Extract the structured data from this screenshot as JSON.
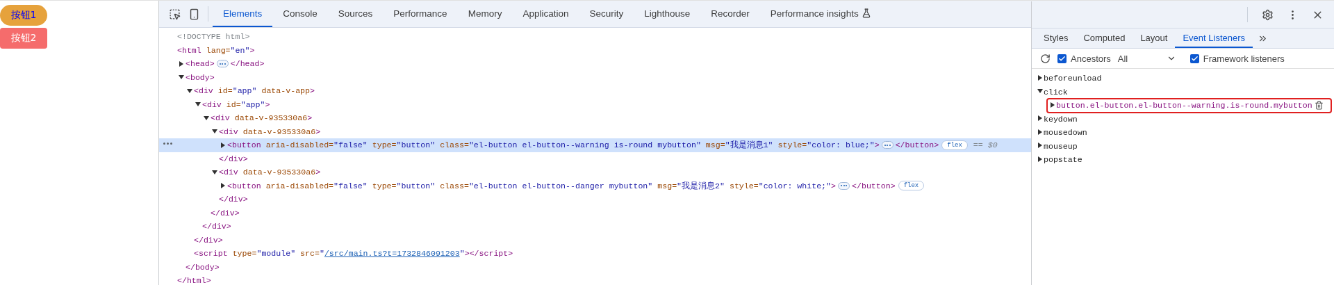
{
  "page": {
    "buttons": [
      {
        "label": "按钮1",
        "kind": "warning"
      },
      {
        "label": "按钮2",
        "kind": "danger"
      }
    ]
  },
  "devtools": {
    "tabs": [
      {
        "label": "Elements",
        "selected": true
      },
      {
        "label": "Console",
        "selected": false
      },
      {
        "label": "Sources",
        "selected": false
      },
      {
        "label": "Performance",
        "selected": false
      },
      {
        "label": "Memory",
        "selected": false
      },
      {
        "label": "Application",
        "selected": false
      },
      {
        "label": "Security",
        "selected": false
      },
      {
        "label": "Lighthouse",
        "selected": false
      },
      {
        "label": "Recorder",
        "selected": false
      },
      {
        "label": "Performance insights",
        "selected": false,
        "experimental": true
      }
    ],
    "dom_tree": [
      {
        "selected": false,
        "tokens": [
          {
            "kind": "doctype",
            "text": "<!DOCTYPE html>"
          }
        ]
      },
      {
        "selected": false,
        "tokens": [
          {
            "kind": "tag",
            "text": "<html"
          },
          {
            "kind": "attr",
            "text": " lang="
          },
          {
            "kind": "value",
            "text": "\"en\""
          },
          {
            "kind": "tag",
            "text": ">"
          }
        ],
        "children": [
          {
            "selected": false,
            "expanded": false,
            "tokens": [
              {
                "kind": "tag",
                "text": "<head>"
              },
              {
                "kind": "more"
              },
              {
                "kind": "tag",
                "text": "</head>"
              }
            ]
          },
          {
            "selected": false,
            "expanded": true,
            "tokens": [
              {
                "kind": "tag",
                "text": "<body>"
              }
            ],
            "children": [
              {
                "selected": false,
                "expanded": true,
                "tokens": [
                  {
                    "kind": "tag",
                    "text": "<div"
                  },
                  {
                    "kind": "attr",
                    "text": " id="
                  },
                  {
                    "kind": "value",
                    "text": "\"app\""
                  },
                  {
                    "kind": "attr",
                    "text": " data-v-app"
                  },
                  {
                    "kind": "tag",
                    "text": ">"
                  }
                ],
                "children": [
                  {
                    "selected": false,
                    "expanded": true,
                    "tokens": [
                      {
                        "kind": "tag",
                        "text": "<div"
                      },
                      {
                        "kind": "attr",
                        "text": " id="
                      },
                      {
                        "kind": "value",
                        "text": "\"app\""
                      },
                      {
                        "kind": "tag",
                        "text": ">"
                      }
                    ],
                    "children": [
                      {
                        "selected": false,
                        "expanded": true,
                        "tokens": [
                          {
                            "kind": "tag",
                            "text": "<div"
                          },
                          {
                            "kind": "attr",
                            "text": " data-v-935330a6"
                          },
                          {
                            "kind": "tag",
                            "text": ">"
                          }
                        ],
                        "children": [
                          {
                            "selected": false,
                            "expanded": true,
                            "tokens": [
                              {
                                "kind": "tag",
                                "text": "<div"
                              },
                              {
                                "kind": "attr",
                                "text": " data-v-935330a6"
                              },
                              {
                                "kind": "tag",
                                "text": ">"
                              }
                            ],
                            "children": [
                              {
                                "selected": true,
                                "expanded": false,
                                "tokens": [
                                  {
                                    "kind": "tag",
                                    "text": "<button"
                                  },
                                  {
                                    "kind": "attr",
                                    "text": " aria-disabled="
                                  },
                                  {
                                    "kind": "value",
                                    "text": "\"false\""
                                  },
                                  {
                                    "kind": "attr",
                                    "text": " type="
                                  },
                                  {
                                    "kind": "value",
                                    "text": "\"button\""
                                  },
                                  {
                                    "kind": "attr",
                                    "text": " class="
                                  },
                                  {
                                    "kind": "value",
                                    "text": "\"el-button el-button--warning is-round mybutton\""
                                  },
                                  {
                                    "kind": "attr",
                                    "text": " msg="
                                  },
                                  {
                                    "kind": "value",
                                    "text": "\"我是消息1\""
                                  },
                                  {
                                    "kind": "attr",
                                    "text": " style="
                                  },
                                  {
                                    "kind": "value",
                                    "text": "\"color: blue;\""
                                  },
                                  {
                                    "kind": "tag",
                                    "text": ">"
                                  },
                                  {
                                    "kind": "more"
                                  },
                                  {
                                    "kind": "tag",
                                    "text": "</button>"
                                  },
                                  {
                                    "kind": "badge",
                                    "text": "flex"
                                  },
                                  {
                                    "kind": "hint",
                                    "text": "== $0"
                                  }
                                ]
                              }
                            ],
                            "close": [
                              {
                                "kind": "tag",
                                "text": "</div>"
                              }
                            ]
                          },
                          {
                            "selected": false,
                            "expanded": true,
                            "tokens": [
                              {
                                "kind": "tag",
                                "text": "<div"
                              },
                              {
                                "kind": "attr",
                                "text": " data-v-935330a6"
                              },
                              {
                                "kind": "tag",
                                "text": ">"
                              }
                            ],
                            "children": [
                              {
                                "selected": false,
                                "expanded": false,
                                "tokens": [
                                  {
                                    "kind": "tag",
                                    "text": "<button"
                                  },
                                  {
                                    "kind": "attr",
                                    "text": " aria-disabled="
                                  },
                                  {
                                    "kind": "value",
                                    "text": "\"false\""
                                  },
                                  {
                                    "kind": "attr",
                                    "text": " type="
                                  },
                                  {
                                    "kind": "value",
                                    "text": "\"button\""
                                  },
                                  {
                                    "kind": "attr",
                                    "text": " class="
                                  },
                                  {
                                    "kind": "value",
                                    "text": "\"el-button el-button--danger mybutton\""
                                  },
                                  {
                                    "kind": "attr",
                                    "text": " msg="
                                  },
                                  {
                                    "kind": "value",
                                    "text": "\"我是消息2\""
                                  },
                                  {
                                    "kind": "attr",
                                    "text": " style="
                                  },
                                  {
                                    "kind": "value",
                                    "text": "\"color: white;\""
                                  },
                                  {
                                    "kind": "tag",
                                    "text": ">"
                                  },
                                  {
                                    "kind": "more"
                                  },
                                  {
                                    "kind": "tag",
                                    "text": "</button>"
                                  },
                                  {
                                    "kind": "badge",
                                    "text": "flex"
                                  }
                                ]
                              }
                            ],
                            "close": [
                              {
                                "kind": "tag",
                                "text": "</div>"
                              }
                            ]
                          }
                        ],
                        "close": [
                          {
                            "kind": "tag",
                            "text": "</div>"
                          }
                        ]
                      }
                    ],
                    "close": [
                      {
                        "kind": "tag",
                        "text": "</div>"
                      }
                    ]
                  }
                ],
                "close": [
                  {
                    "kind": "tag",
                    "text": "</div>"
                  }
                ]
              },
              {
                "selected": false,
                "tokens": [
                  {
                    "kind": "tag",
                    "text": "<script"
                  },
                  {
                    "kind": "attr",
                    "text": " type="
                  },
                  {
                    "kind": "value",
                    "text": "\"module\""
                  },
                  {
                    "kind": "attr",
                    "text": " src="
                  },
                  {
                    "kind": "value",
                    "text": "\""
                  },
                  {
                    "kind": "link",
                    "text": "/src/main.ts?t=1732846091203"
                  },
                  {
                    "kind": "value",
                    "text": "\""
                  },
                  {
                    "kind": "tag",
                    "text": "></script>"
                  }
                ]
              }
            ],
            "close": [
              {
                "kind": "tag",
                "text": "</body>"
              }
            ]
          }
        ],
        "close": [
          {
            "kind": "tag",
            "text": "</html>"
          }
        ]
      }
    ],
    "sidebar": {
      "tabs": [
        {
          "label": "Styles",
          "selected": false
        },
        {
          "label": "Computed",
          "selected": false
        },
        {
          "label": "Layout",
          "selected": false
        },
        {
          "label": "Event Listeners",
          "selected": true
        }
      ],
      "ancestors": {
        "label": "Ancestors",
        "checked": true
      },
      "filter": {
        "value": "All"
      },
      "framework": {
        "label": "Framework listeners",
        "checked": true
      },
      "events": [
        {
          "name": "beforeunload",
          "expanded": false
        },
        {
          "name": "click",
          "expanded": true,
          "children": [
            {
              "name": "button.el-button.el-button--warning.is-round.mybutton",
              "expanded": false,
              "highlighted": true
            }
          ]
        },
        {
          "name": "keydown",
          "expanded": false
        },
        {
          "name": "mousedown",
          "expanded": false
        },
        {
          "name": "mouseup",
          "expanded": false
        },
        {
          "name": "popstate",
          "expanded": false
        }
      ]
    }
  }
}
